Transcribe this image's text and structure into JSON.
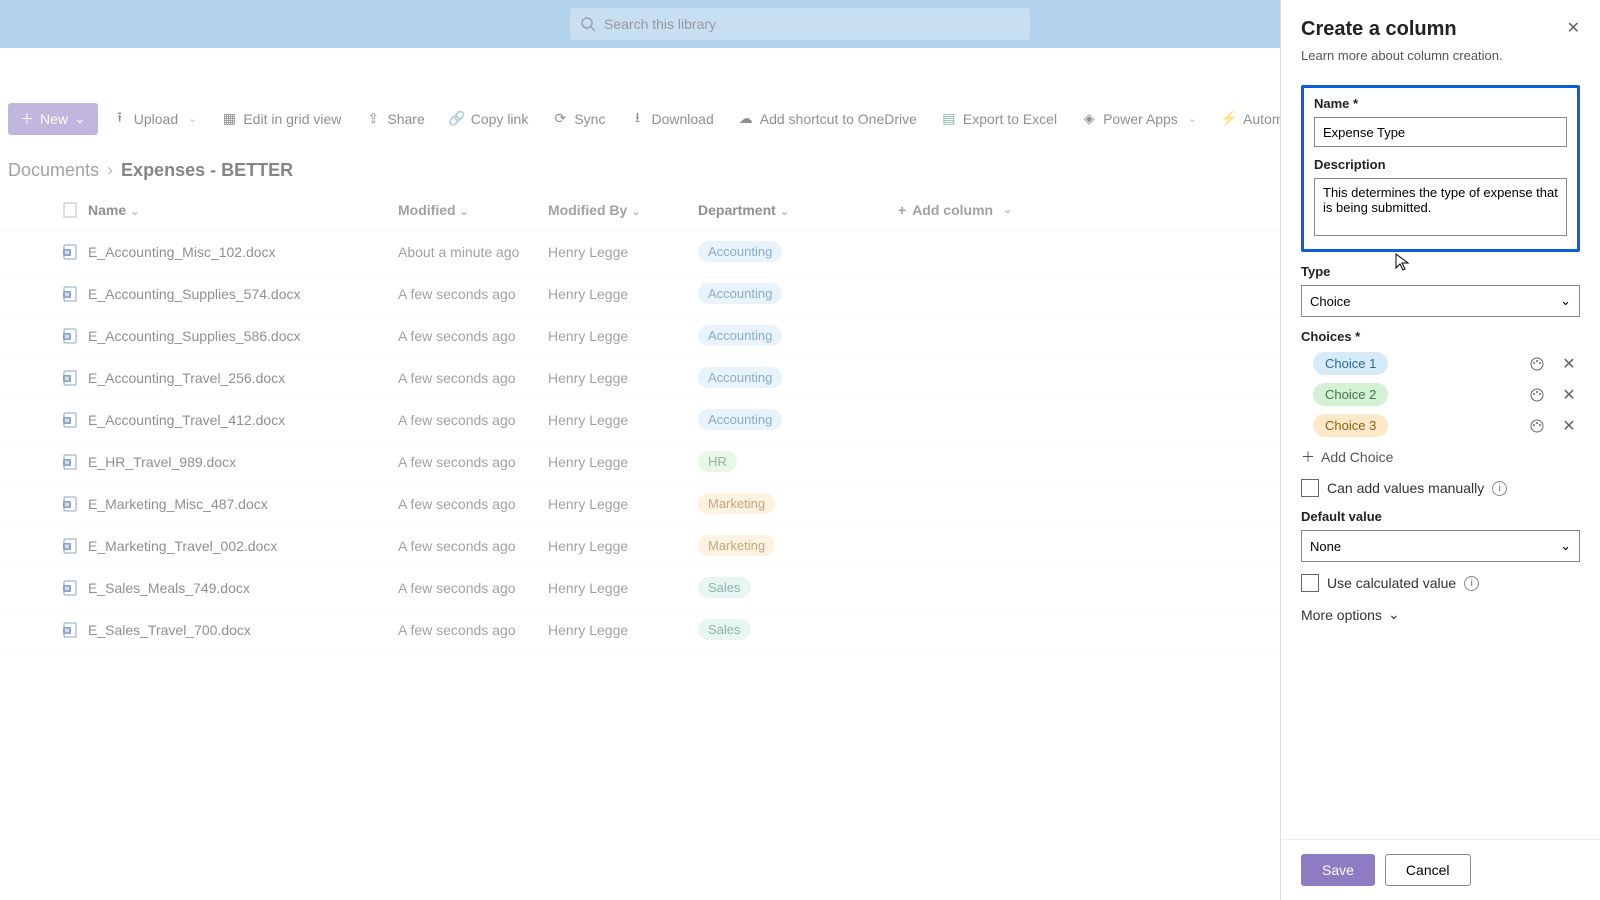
{
  "search": {
    "placeholder": "Search this library"
  },
  "commands": {
    "new": "New",
    "upload": "Upload",
    "grid": "Edit in grid view",
    "share": "Share",
    "copy": "Copy link",
    "sync": "Sync",
    "download": "Download",
    "shortcut": "Add shortcut to OneDrive",
    "excel": "Export to Excel",
    "power": "Power Apps",
    "automate": "Automate"
  },
  "breadcrumb": {
    "root": "Documents",
    "current": "Expenses - BETTER"
  },
  "columns": {
    "name": "Name",
    "modified": "Modified",
    "by": "Modified By",
    "dept": "Department",
    "add": "Add column"
  },
  "rows": [
    {
      "name": "E_Accounting_Misc_102.docx",
      "mod": "About a minute ago",
      "by": "Henry Legge",
      "dept": "Accounting",
      "cls": "acc"
    },
    {
      "name": "E_Accounting_Supplies_574.docx",
      "mod": "A few seconds ago",
      "by": "Henry Legge",
      "dept": "Accounting",
      "cls": "acc"
    },
    {
      "name": "E_Accounting_Supplies_586.docx",
      "mod": "A few seconds ago",
      "by": "Henry Legge",
      "dept": "Accounting",
      "cls": "acc"
    },
    {
      "name": "E_Accounting_Travel_256.docx",
      "mod": "A few seconds ago",
      "by": "Henry Legge",
      "dept": "Accounting",
      "cls": "acc"
    },
    {
      "name": "E_Accounting_Travel_412.docx",
      "mod": "A few seconds ago",
      "by": "Henry Legge",
      "dept": "Accounting",
      "cls": "acc"
    },
    {
      "name": "E_HR_Travel_989.docx",
      "mod": "A few seconds ago",
      "by": "Henry Legge",
      "dept": "HR",
      "cls": "hr"
    },
    {
      "name": "E_Marketing_Misc_487.docx",
      "mod": "A few seconds ago",
      "by": "Henry Legge",
      "dept": "Marketing",
      "cls": "mkt"
    },
    {
      "name": "E_Marketing_Travel_002.docx",
      "mod": "A few seconds ago",
      "by": "Henry Legge",
      "dept": "Marketing",
      "cls": "mkt"
    },
    {
      "name": "E_Sales_Meals_749.docx",
      "mod": "A few seconds ago",
      "by": "Henry Legge",
      "dept": "Sales",
      "cls": "sal"
    },
    {
      "name": "E_Sales_Travel_700.docx",
      "mod": "A few seconds ago",
      "by": "Henry Legge",
      "dept": "Sales",
      "cls": "sal"
    }
  ],
  "panel": {
    "title": "Create a column",
    "learn": "Learn more about column creation.",
    "name_label": "Name *",
    "name_value": "Expense Type",
    "desc_label": "Description",
    "desc_value": "This determines the type of expense that is being submitted.",
    "type_label": "Type",
    "type_value": "Choice",
    "choices_label": "Choices *",
    "choices": [
      {
        "label": "Choice 1",
        "cls": "c1"
      },
      {
        "label": "Choice 2",
        "cls": "c2"
      },
      {
        "label": "Choice 3",
        "cls": "c3"
      }
    ],
    "add_choice": "Add Choice",
    "manual": "Can add values manually",
    "default_label": "Default value",
    "default_value": "None",
    "calc": "Use calculated value",
    "more": "More options",
    "save": "Save",
    "cancel": "Cancel"
  }
}
